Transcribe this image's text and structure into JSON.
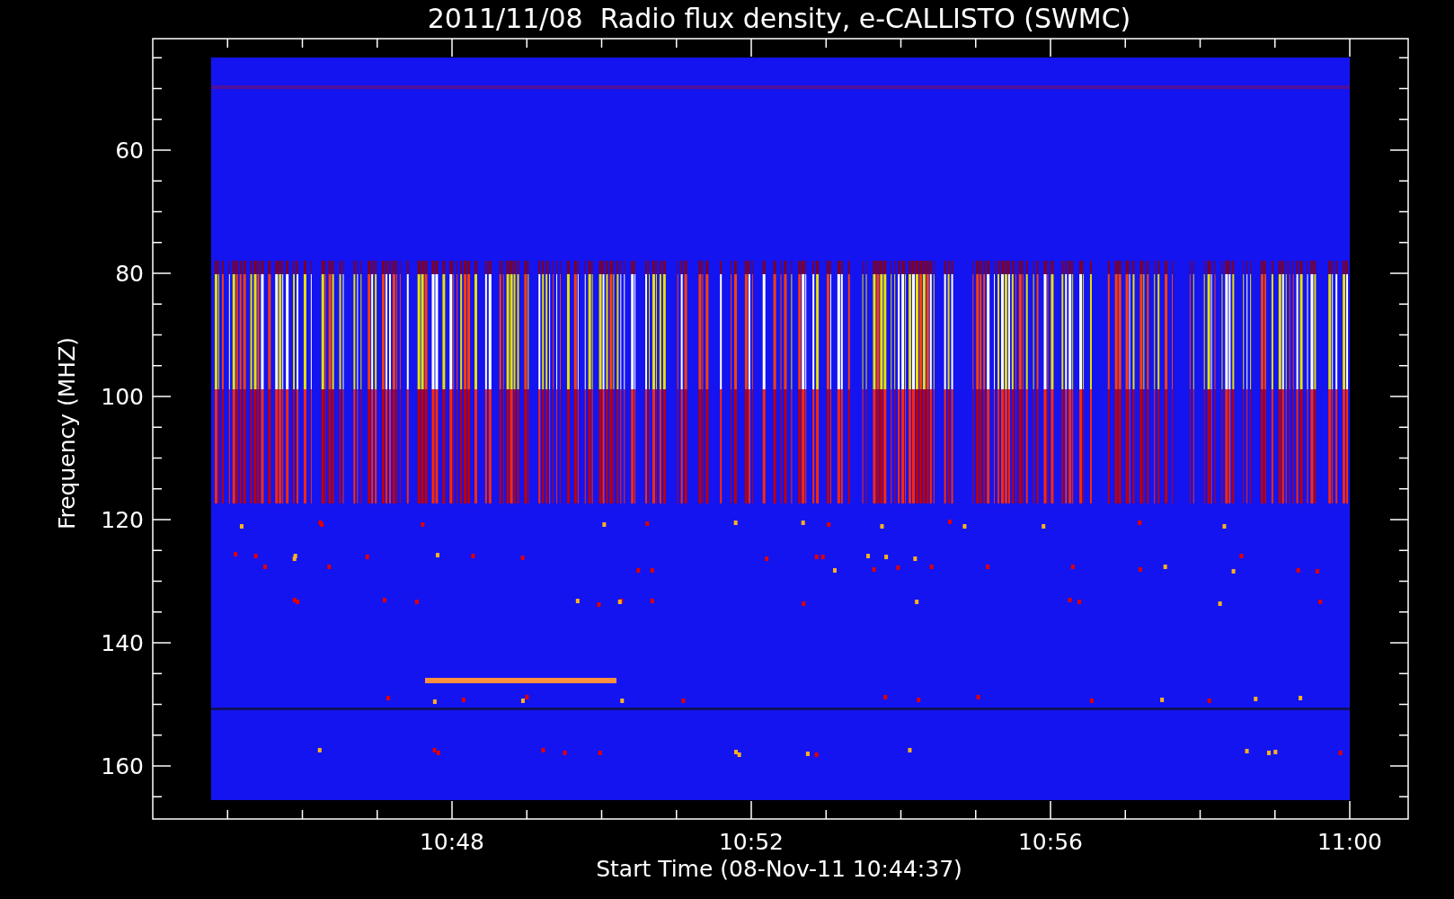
{
  "plot": {
    "title": "2011/11/08  Radio flux density, e-CALLISTO (SWMC)",
    "ylabel": "Frequency (MHZ)",
    "xlabel": "Start Time (08-Nov-11 10:44:37)",
    "yticks": [
      "60",
      "80",
      "100",
      "120",
      "140",
      "160"
    ],
    "xticks": [
      "10:48",
      "10:52",
      "10:56",
      "11:00"
    ]
  }
}
